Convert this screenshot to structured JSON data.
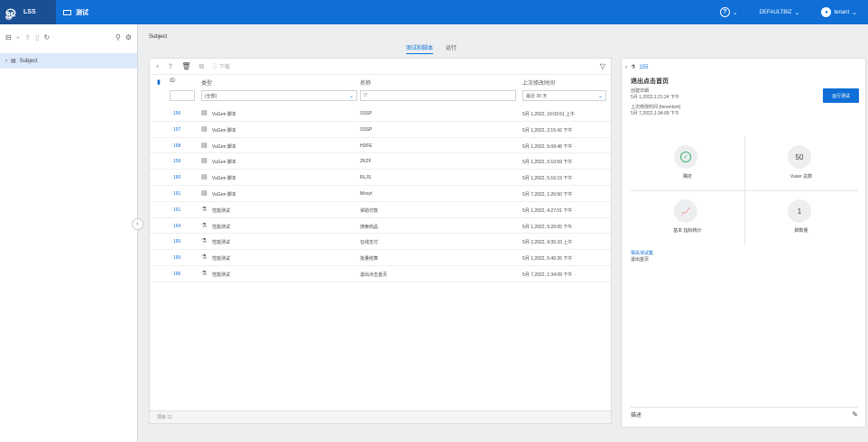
{
  "topbar": {
    "brand_label": "LSS",
    "tab_label": "测试",
    "user_menu": "DEFAULTBIZ",
    "account": "tenant"
  },
  "left": {
    "tree_item": "Subject"
  },
  "breadcrumb": "Subject",
  "tabs": [
    {
      "label": "测试和脚本"
    },
    {
      "label": "运行"
    }
  ],
  "table": {
    "download_label": "下载",
    "headers": {
      "id": "ID",
      "type": "类型",
      "name": "名称",
      "last_modified": "上次修改时间"
    },
    "filters": {
      "type": "(全部)",
      "date": "最近 30 天"
    },
    "rows": [
      {
        "id": "156",
        "type": "VuGen 脚本",
        "name": "SSSP",
        "date": "5月 1,2022, 10:03:51 上午"
      },
      {
        "id": "157",
        "type": "VuGen 脚本",
        "name": "SSSP",
        "date": "5月 1,2022, 2:15:42 下午"
      },
      {
        "id": "158",
        "type": "VuGen 脚本",
        "name": "HDFE",
        "date": "5月 1,2022, 5:09:48 下午"
      },
      {
        "id": "159",
        "type": "VuGen 脚本",
        "name": "ZKZF",
        "date": "5月 1,2022, 5:10:59 下午"
      },
      {
        "id": "160",
        "type": "VuGen 脚本",
        "name": "RLJS",
        "date": "5月 1,2022, 5:16:19 下午"
      },
      {
        "id": "161",
        "type": "VuGen 脚本",
        "name": "Mosyt",
        "date": "5月 7,2022, 1:26:50 下午"
      },
      {
        "id": "161",
        "type": "性能测试",
        "name": "资助付款",
        "date": "5月 1,2022, 4:27:01 下午"
      },
      {
        "id": "164",
        "type": "性能测试",
        "name": "搜索商品",
        "date": "5月 1,2022, 5:20:05 下午"
      },
      {
        "id": "165",
        "type": "性能测试",
        "name": "在线支付",
        "date": "5月 2,2022, 9:35:33 上午"
      },
      {
        "id": "165",
        "type": "性能测试",
        "name": "批量结算",
        "date": "5月 1,2022, 5:40:26 下午"
      },
      {
        "id": "166",
        "type": "性能测试",
        "name": "退出点击首页",
        "date": "5月 7,2022, 1:34:09 下午"
      }
    ],
    "footer": "项目 11"
  },
  "detail": {
    "id": "155",
    "title": "退出点击首页",
    "created_label": "创建日期",
    "created_value": "5月 1,2022,1:21:24 下午",
    "modified_label": "上次修改时间 (tenantsnt)",
    "modified_value": "5月 7,2022,1:34:09 下午",
    "run_button": "运行测试",
    "stats": [
      {
        "value": "",
        "label": "确定"
      },
      {
        "value": "50",
        "label": "Vuser 总数"
      },
      {
        "value": "",
        "label": "基本 指标统计"
      },
      {
        "value": "1",
        "label": "脚数量"
      }
    ],
    "link_label": "相关测试集",
    "link_value": "退出首页",
    "desc_label": "描述"
  }
}
